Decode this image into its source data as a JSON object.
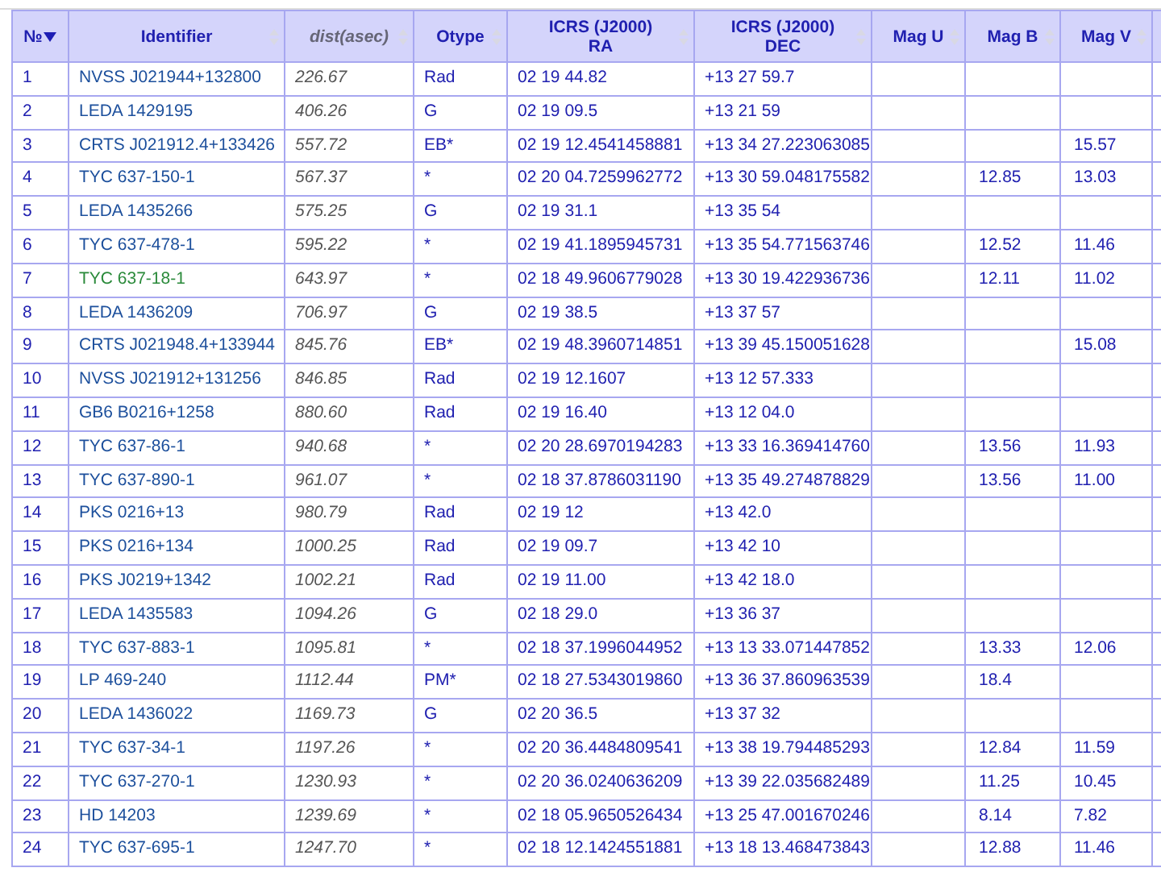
{
  "table": {
    "columns": [
      {
        "label": "№",
        "sorted": true,
        "italic": false
      },
      {
        "label": "Identifier",
        "sorted": false,
        "italic": false
      },
      {
        "label": "dist(asec)",
        "sorted": false,
        "italic": true
      },
      {
        "label": "Otype",
        "sorted": false,
        "italic": false
      },
      {
        "label": "ICRS (J2000)",
        "sublabel": "RA",
        "sorted": false,
        "italic": false
      },
      {
        "label": "ICRS (J2000)",
        "sublabel": "DEC",
        "sorted": false,
        "italic": false
      },
      {
        "label": "Mag U",
        "sorted": false,
        "italic": false
      },
      {
        "label": "Mag B",
        "sorted": false,
        "italic": false
      },
      {
        "label": "Mag V",
        "sorted": false,
        "italic": false
      }
    ],
    "rows": [
      {
        "n": "1",
        "id": "NVSS J021944+132800",
        "visited": false,
        "dist": "226.67",
        "otype": "Rad",
        "ra": "02 19 44.82",
        "dec": "+13 27 59.7"
      },
      {
        "n": "2",
        "id": "LEDA 1429195",
        "visited": false,
        "dist": "406.26",
        "otype": "G",
        "ra": "02 19 09.5",
        "dec": "+13 21 59"
      },
      {
        "n": "3",
        "id": "CRTS J021912.4+133426",
        "visited": false,
        "dist": "557.72",
        "otype": "EB*",
        "ra": "02 19 12.4541458881",
        "dec": "+13 34 27.223063085",
        "mag_v": "15.57"
      },
      {
        "n": "4",
        "id": "TYC 637-150-1",
        "visited": false,
        "dist": "567.37",
        "otype": "*",
        "ra": "02 20 04.7259962772",
        "dec": "+13 30 59.048175582",
        "mag_b": "12.85",
        "mag_v": "13.03"
      },
      {
        "n": "5",
        "id": "LEDA 1435266",
        "visited": false,
        "dist": "575.25",
        "otype": "G",
        "ra": "02 19 31.1",
        "dec": "+13 35 54"
      },
      {
        "n": "6",
        "id": "TYC 637-478-1",
        "visited": false,
        "dist": "595.22",
        "otype": "*",
        "ra": "02 19 41.1895945731",
        "dec": "+13 35 54.771563746",
        "mag_b": "12.52",
        "mag_v": "11.46"
      },
      {
        "n": "7",
        "id": "TYC 637-18-1",
        "visited": true,
        "dist": "643.97",
        "otype": "*",
        "ra": "02 18 49.9606779028",
        "dec": "+13 30 19.422936736",
        "mag_b": "12.11",
        "mag_v": "11.02"
      },
      {
        "n": "8",
        "id": "LEDA 1436209",
        "visited": false,
        "dist": "706.97",
        "otype": "G",
        "ra": "02 19 38.5",
        "dec": "+13 37 57"
      },
      {
        "n": "9",
        "id": "CRTS J021948.4+133944",
        "visited": false,
        "dist": "845.76",
        "otype": "EB*",
        "ra": "02 19 48.3960714851",
        "dec": "+13 39 45.150051628",
        "mag_v": "15.08"
      },
      {
        "n": "10",
        "id": "NVSS J021912+131256",
        "visited": false,
        "dist": "846.85",
        "otype": "Rad",
        "ra": "02 19 12.1607",
        "dec": "+13 12 57.333"
      },
      {
        "n": "11",
        "id": "GB6 B0216+1258",
        "visited": false,
        "dist": "880.60",
        "otype": "Rad",
        "ra": "02 19 16.40",
        "dec": "+13 12 04.0"
      },
      {
        "n": "12",
        "id": "TYC 637-86-1",
        "visited": false,
        "dist": "940.68",
        "otype": "*",
        "ra": "02 20 28.6970194283",
        "dec": "+13 33 16.369414760",
        "mag_b": "13.56",
        "mag_v": "11.93"
      },
      {
        "n": "13",
        "id": "TYC 637-890-1",
        "visited": false,
        "dist": "961.07",
        "otype": "*",
        "ra": "02 18 37.8786031190",
        "dec": "+13 35 49.274878829",
        "mag_b": "13.56",
        "mag_v": "11.00"
      },
      {
        "n": "14",
        "id": "PKS 0216+13",
        "visited": false,
        "dist": "980.79",
        "otype": "Rad",
        "ra": "02 19 12",
        "dec": "+13 42.0"
      },
      {
        "n": "15",
        "id": "PKS 0216+134",
        "visited": false,
        "dist": "1000.25",
        "otype": "Rad",
        "ra": "02 19 09.7",
        "dec": "+13 42 10"
      },
      {
        "n": "16",
        "id": "PKS J0219+1342",
        "visited": false,
        "dist": "1002.21",
        "otype": "Rad",
        "ra": "02 19 11.00",
        "dec": "+13 42 18.0"
      },
      {
        "n": "17",
        "id": "LEDA 1435583",
        "visited": false,
        "dist": "1094.26",
        "otype": "G",
        "ra": "02 18 29.0",
        "dec": "+13 36 37"
      },
      {
        "n": "18",
        "id": "TYC 637-883-1",
        "visited": false,
        "dist": "1095.81",
        "otype": "*",
        "ra": "02 18 37.1996044952",
        "dec": "+13 13 33.071447852",
        "mag_b": "13.33",
        "mag_v": "12.06"
      },
      {
        "n": "19",
        "id": "LP 469-240",
        "visited": false,
        "dist": "1112.44",
        "otype": "PM*",
        "ra": "02 18 27.5343019860",
        "dec": "+13 36 37.860963539",
        "mag_b": "18.4"
      },
      {
        "n": "20",
        "id": "LEDA 1436022",
        "visited": false,
        "dist": "1169.73",
        "otype": "G",
        "ra": "02 20 36.5",
        "dec": "+13 37 32"
      },
      {
        "n": "21",
        "id": "TYC 637-34-1",
        "visited": false,
        "dist": "1197.26",
        "otype": "*",
        "ra": "02 20 36.4484809541",
        "dec": "+13 38 19.794485293",
        "mag_b": "12.84",
        "mag_v": "11.59"
      },
      {
        "n": "22",
        "id": "TYC 637-270-1",
        "visited": false,
        "dist": "1230.93",
        "otype": "*",
        "ra": "02 20 36.0240636209",
        "dec": "+13 39 22.035682489",
        "mag_b": "11.25",
        "mag_v": "10.45"
      },
      {
        "n": "23",
        "id": "HD 14203",
        "visited": false,
        "dist": "1239.69",
        "otype": "*",
        "ra": "02 18 05.9650526434",
        "dec": "+13 25 47.001670246",
        "mag_b": "8.14",
        "mag_v": "7.82"
      },
      {
        "n": "24",
        "id": "TYC 637-695-1",
        "visited": false,
        "dist": "1247.70",
        "otype": "*",
        "ra": "02 18 12.1424551881",
        "dec": "+13 18 13.468473843",
        "mag_b": "12.88",
        "mag_v": "11.46"
      }
    ]
  }
}
